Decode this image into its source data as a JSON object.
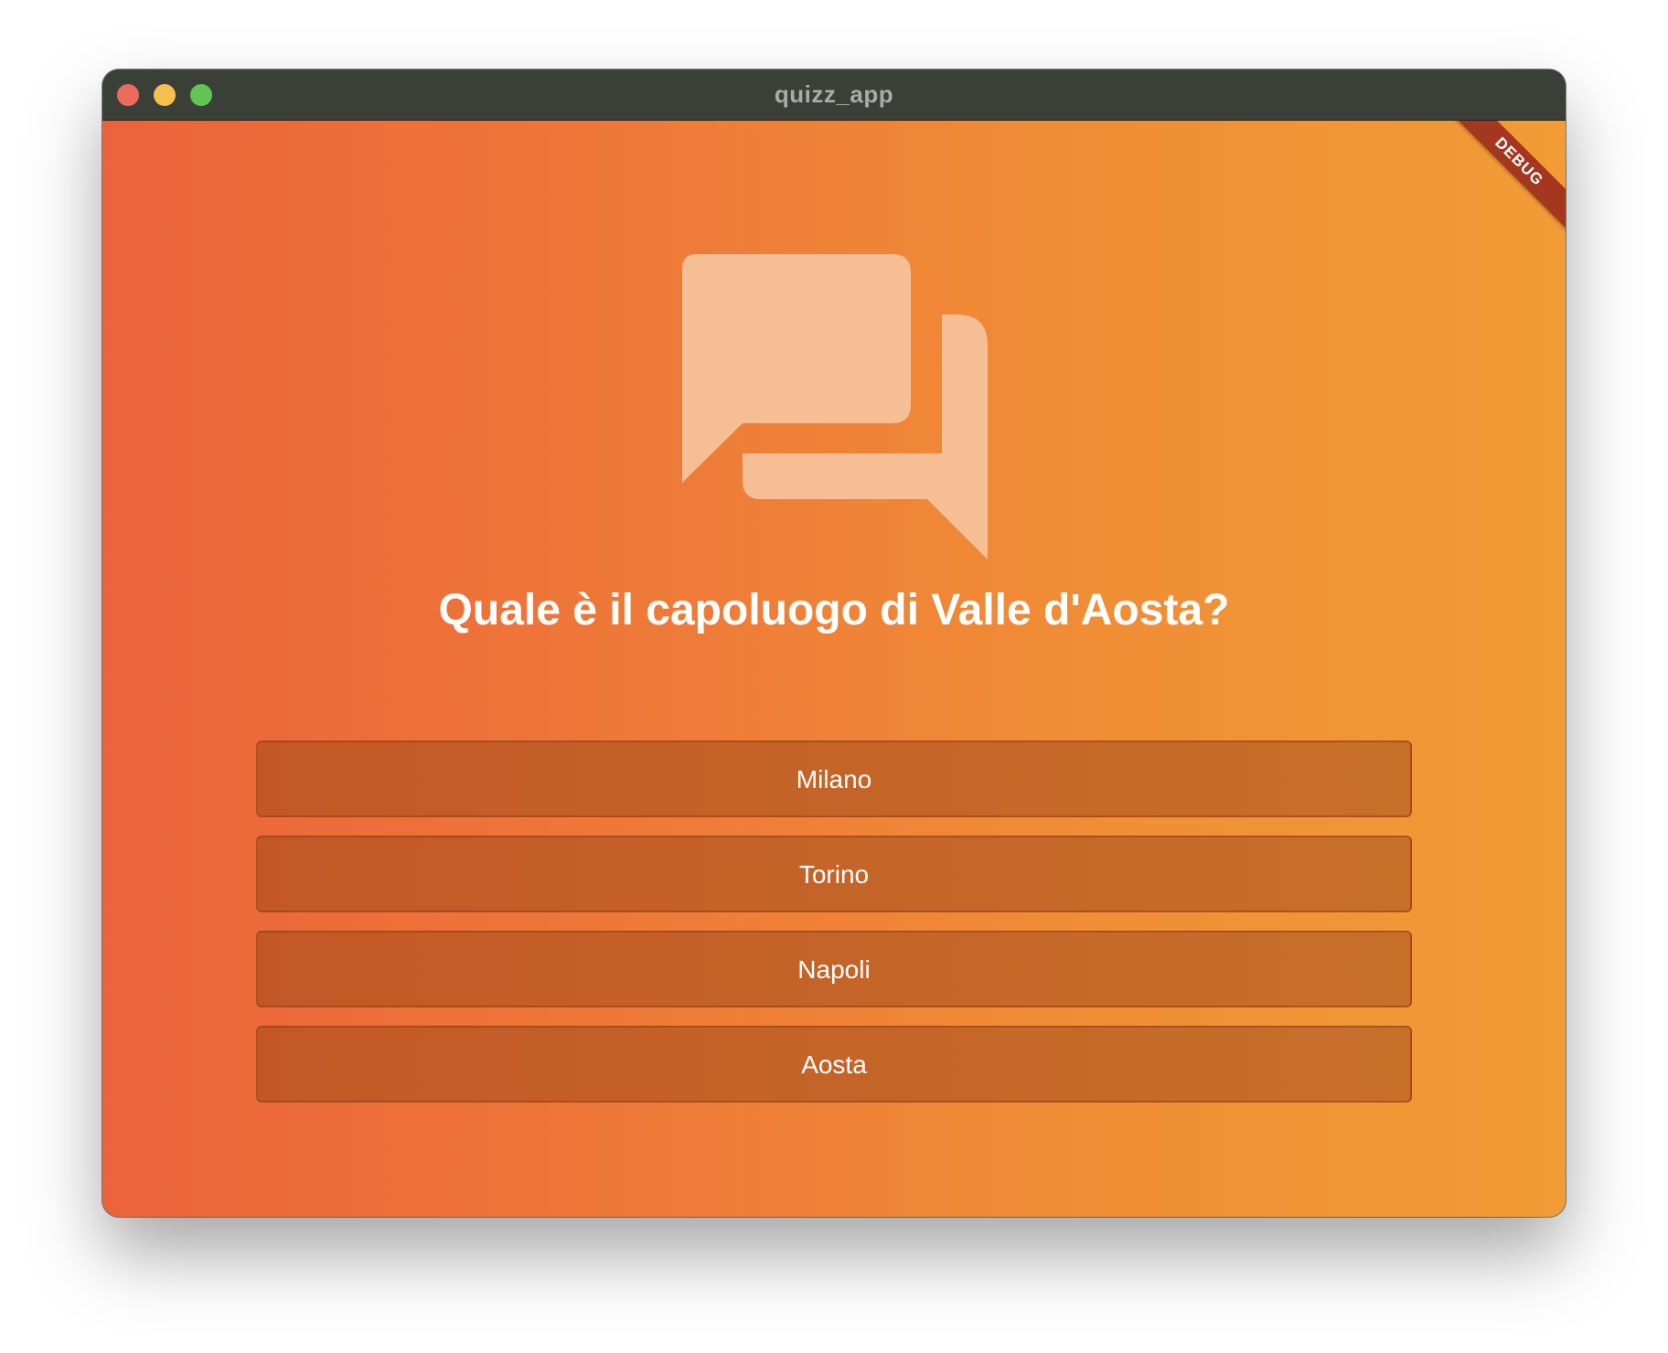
{
  "window": {
    "title": "quizz_app"
  },
  "debug_banner": "DEBUG",
  "icons": {
    "main": "chat-bubbles-icon"
  },
  "colors": {
    "gradient_start": "#eb633b",
    "gradient_end": "#f19c36",
    "icon_color": "#f5be95",
    "button_bg": "#c35826",
    "debug_banner": "#a6371f"
  },
  "quiz": {
    "question": "Quale è il capoluogo di Valle d'Aosta?",
    "answers": [
      "Milano",
      "Torino",
      "Napoli",
      "Aosta"
    ]
  }
}
